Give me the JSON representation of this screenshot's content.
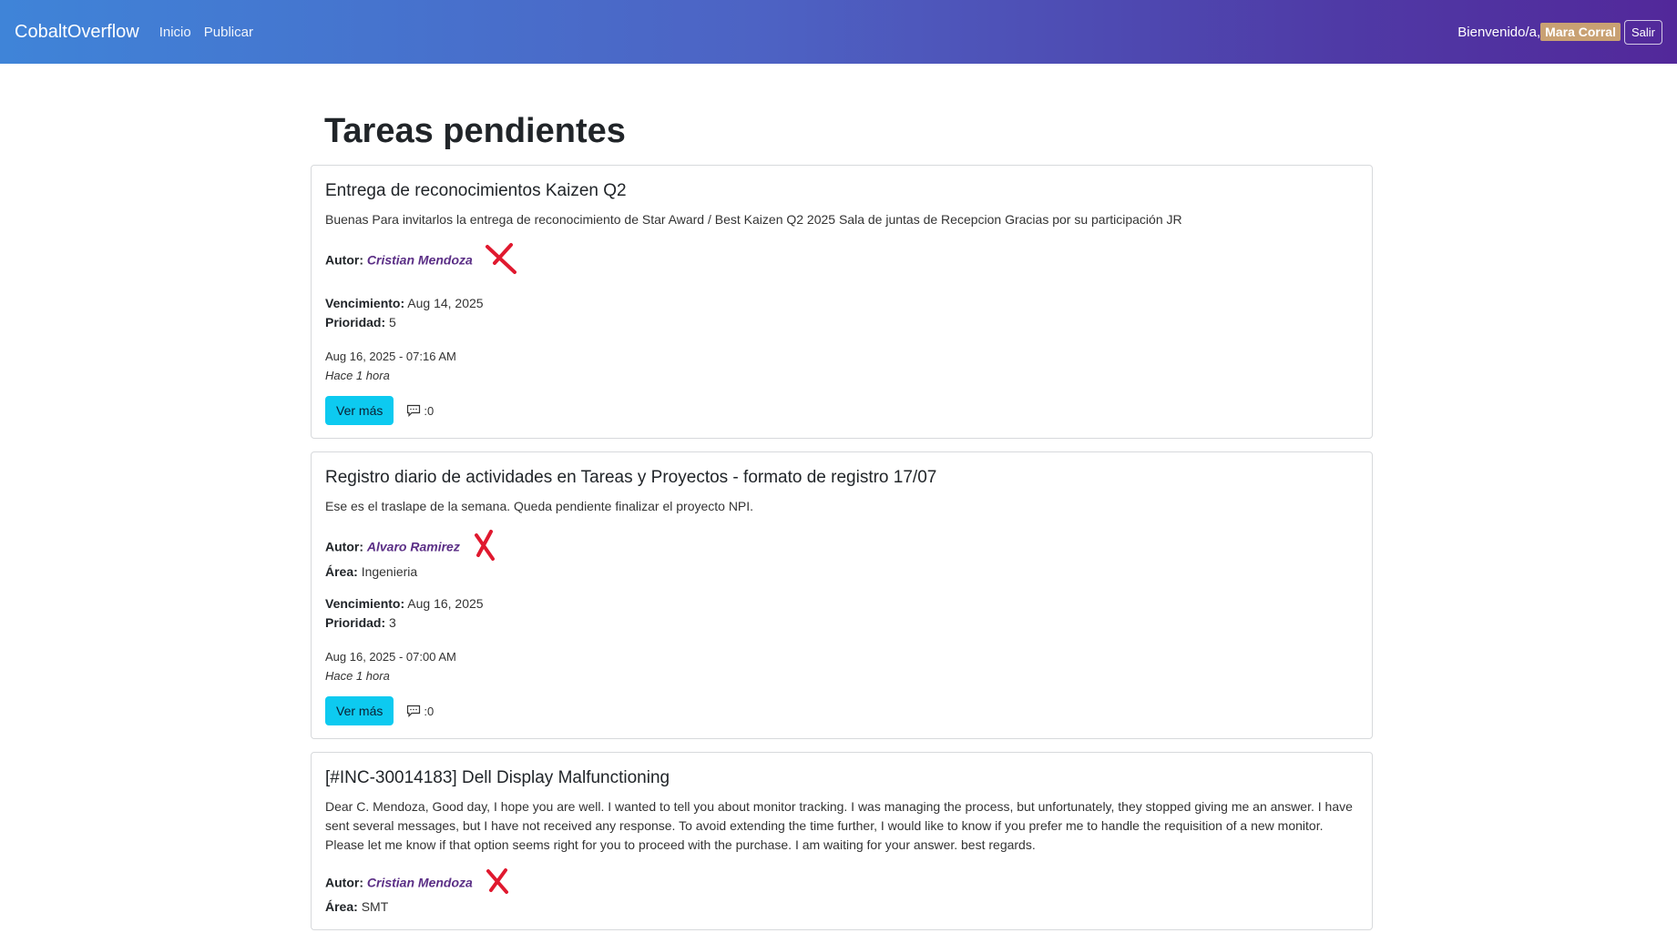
{
  "nav": {
    "brand": "CobaltOverflow",
    "links": [
      "Inicio",
      "Publicar"
    ],
    "welcome": "Bienvenido/a,",
    "user": "Mara Corral",
    "logout": "Salir"
  },
  "page": {
    "title": "Tareas pendientes"
  },
  "labels": {
    "author": "Autor:",
    "area": "Área:",
    "due": "Vencimiento:",
    "priority": "Prioridad:",
    "more": "Ver más",
    "comment_sep": ": "
  },
  "tasks": [
    {
      "title": "Entrega de reconocimientos Kaizen Q2",
      "body": "Buenas Para invitarlos la entrega de reconocimiento de Star Award / Best Kaizen Q2 2025 Sala de juntas de Recepcion Gracias por su participación JR",
      "author": "Cristian Mendoza",
      "due": "Aug 14, 2025",
      "priority": "5",
      "created": "Aug 16, 2025 - 07:16 AM",
      "ago": "Hace 1 hora",
      "comments": "0"
    },
    {
      "title": "Registro diario de actividades en Tareas y Proyectos - formato de registro 17/07",
      "body": "Ese es el traslape de la semana. Queda pendiente finalizar el proyecto NPI.",
      "author": "Alvaro Ramirez",
      "area": "Ingenieria",
      "due": "Aug 16, 2025",
      "priority": "3",
      "created": "Aug 16, 2025 - 07:00 AM",
      "ago": "Hace 1 hora",
      "comments": "0"
    },
    {
      "title": "[#INC-30014183] Dell Display Malfunctioning",
      "body": "Dear C. Mendoza, Good day, I hope you are well. I wanted to tell you about monitor tracking. I was managing the process, but unfortunately, they stopped giving me an answer. I have sent several messages, but I have not received any response. To avoid extending the time further, I would like to know if you prefer me to handle the requisition of a new monitor. Please let me know if that option seems right for you to proceed with the purchase. I am waiting for your answer. best regards.",
      "author": "Cristian Mendoza",
      "area": "SMT"
    }
  ],
  "colors": {
    "accent": "#0dcaf0",
    "author": "#5b2f86",
    "cross": "#e0192f"
  }
}
